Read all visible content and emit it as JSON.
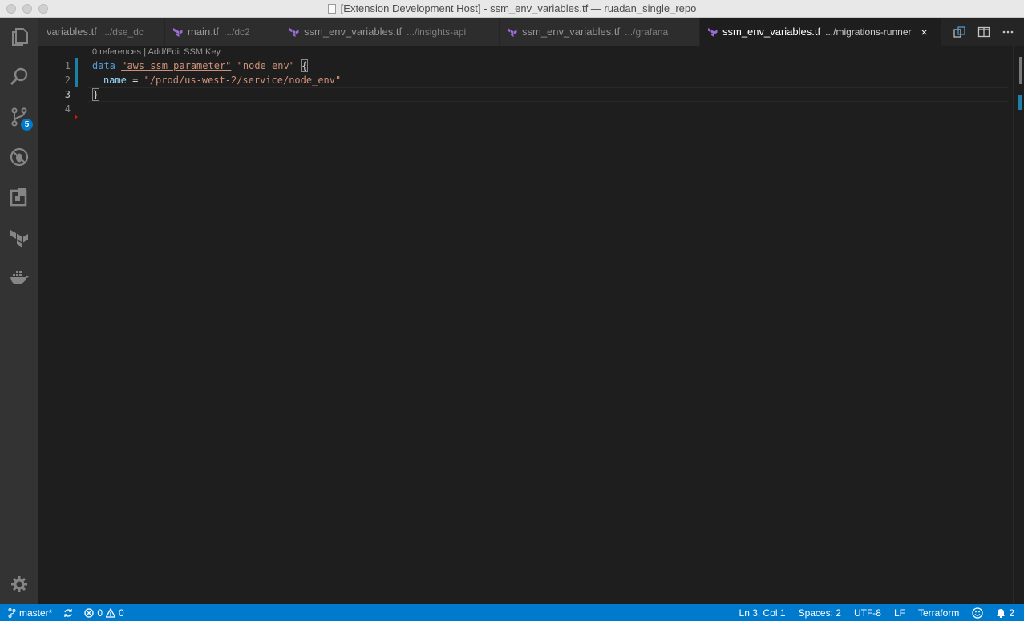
{
  "window": {
    "title": "[Extension Development Host] - ssm_env_variables.tf — ruadan_single_repo"
  },
  "activity_bar": {
    "items": [
      {
        "name": "explorer",
        "icon": "files-icon"
      },
      {
        "name": "search",
        "icon": "search-icon"
      },
      {
        "name": "source-control",
        "icon": "git-branch-icon",
        "badge": "5"
      },
      {
        "name": "debug",
        "icon": "debug-icon"
      },
      {
        "name": "extensions",
        "icon": "extensions-icon"
      },
      {
        "name": "terraform",
        "icon": "terraform-icon"
      },
      {
        "name": "docker",
        "icon": "docker-icon"
      }
    ],
    "settings_icon": "gear-icon"
  },
  "tabs": [
    {
      "file": "variables.tf",
      "path": ".../dse_dc",
      "active": false,
      "icon": false
    },
    {
      "file": "main.tf",
      "path": ".../dc2",
      "active": false,
      "icon": true
    },
    {
      "file": "ssm_env_variables.tf",
      "path": ".../insights-api",
      "active": false,
      "icon": true
    },
    {
      "file": "ssm_env_variables.tf",
      "path": ".../grafana",
      "active": false,
      "icon": true
    },
    {
      "file": "ssm_env_variables.tf",
      "path": ".../migrations-runner",
      "active": true,
      "icon": true
    }
  ],
  "tab_close": "×",
  "editor": {
    "codelens": "0 references | Add/Edit SSM Key",
    "line_numbers": [
      "1",
      "2",
      "3",
      "4"
    ],
    "line1": {
      "kw": "data",
      "s1": "\"aws_ssm_parameter\"",
      "s2": "\"node_env\"",
      "brace": "{"
    },
    "line2": {
      "attr": "name",
      "eq": " = ",
      "val": "\"/prod/us-west-2/service/node_env\""
    },
    "line3": {
      "brace": "}"
    }
  },
  "status_bar": {
    "branch": "master*",
    "errors": "0",
    "warnings": "0",
    "cursor": "Ln 3, Col 1",
    "spaces": "Spaces: 2",
    "encoding": "UTF-8",
    "eol": "LF",
    "language": "Terraform",
    "notifications": "2"
  },
  "colors": {
    "status_bar": "#007acc",
    "activity_bar": "#333333",
    "editor_bg": "#1e1e1e",
    "terraform_purple": "#7b42bc"
  }
}
